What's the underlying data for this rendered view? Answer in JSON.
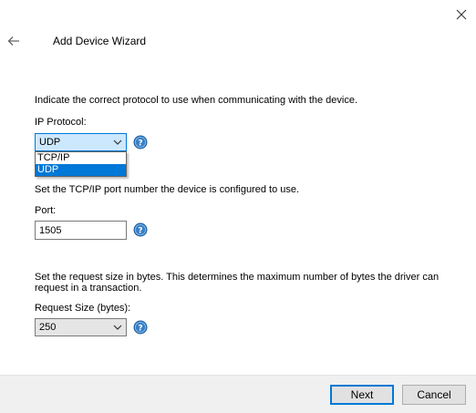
{
  "window": {
    "title": "Add Device Wizard"
  },
  "protocol": {
    "description": "Indicate the correct protocol to use when communicating with the device.",
    "label": "IP Protocol:",
    "value": "UDP",
    "options": [
      "TCP/IP",
      "UDP"
    ],
    "highlighted_option": "UDP"
  },
  "port": {
    "description": "Set the TCP/IP port number the device is configured to use.",
    "label": "Port:",
    "value": "1505"
  },
  "request_size": {
    "description": "Set the request size in bytes. This determines the maximum number of bytes the driver can request in a transaction.",
    "label": "Request Size (bytes):",
    "value": "250"
  },
  "footer": {
    "next_label": "Next",
    "cancel_label": "Cancel"
  },
  "icons": {
    "close": "close-icon",
    "back": "back-arrow-icon",
    "help": "help-icon",
    "chevron": "chevron-down-icon"
  },
  "colors": {
    "accent": "#0078d7",
    "help_blue": "#3a7fc4",
    "footer_bg": "#f0f0f0"
  }
}
